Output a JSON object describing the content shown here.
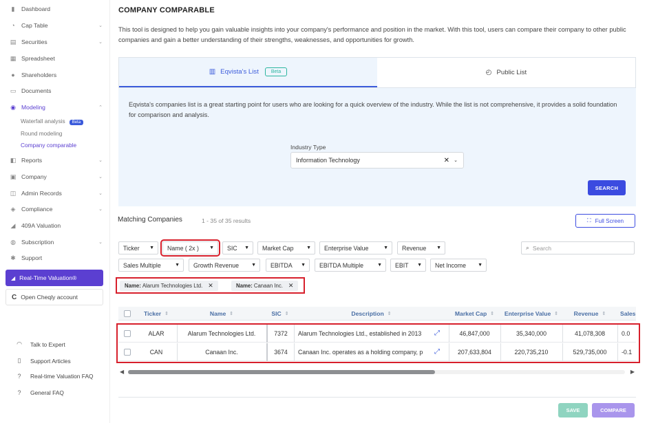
{
  "sidebar": {
    "items": [
      {
        "label": "Dashboard",
        "icon": "dashboard-icon",
        "chevron": false
      },
      {
        "label": "Cap Table",
        "icon": "pie-chart-icon",
        "chevron": true
      },
      {
        "label": "Securities",
        "icon": "document-stack-icon",
        "chevron": true
      },
      {
        "label": "Spreadsheet",
        "icon": "spreadsheet-icon",
        "chevron": false
      },
      {
        "label": "Shareholders",
        "icon": "person-icon",
        "chevron": false
      },
      {
        "label": "Documents",
        "icon": "folder-icon",
        "chevron": false
      },
      {
        "label": "Modeling",
        "icon": "lightbulb-icon",
        "chevron": true
      },
      {
        "label": "Reports",
        "icon": "chart-icon",
        "chevron": true
      },
      {
        "label": "Company",
        "icon": "building-icon",
        "chevron": true
      },
      {
        "label": "Admin Records",
        "icon": "records-icon",
        "chevron": true
      },
      {
        "label": "Compliance",
        "icon": "shield-icon",
        "chevron": true
      },
      {
        "label": "409A Valuation",
        "icon": "valuation-icon",
        "chevron": false
      },
      {
        "label": "Subscription",
        "icon": "subscription-icon",
        "chevron": true
      },
      {
        "label": "Support",
        "icon": "support-icon",
        "chevron": false
      }
    ],
    "modeling_sub": [
      {
        "label": "Waterfall analysis",
        "badge": "Beta"
      },
      {
        "label": "Round modeling",
        "badge": ""
      },
      {
        "label": "Company comparable",
        "badge": ""
      }
    ],
    "rtv_button": "Real-Time Valuation®",
    "cheqly_button": "Open Cheqly account",
    "footer": [
      {
        "label": "Talk to Expert",
        "icon": "headset-icon"
      },
      {
        "label": "Support Articles",
        "icon": "book-icon"
      },
      {
        "label": "Real-time Valuation FAQ",
        "icon": "question-icon"
      },
      {
        "label": "General FAQ",
        "icon": "question-icon"
      }
    ]
  },
  "main": {
    "title": "COMPANY COMPARABLE",
    "intro": "This tool is designed to help you gain valuable insights into your company's performance and position in the market. With this tool, users can compare their company to other public companies and gain a better understanding of their strengths, weaknesses, and opportunities for growth.",
    "tabs": [
      {
        "label": "Eqvista's List",
        "badge": "Beta",
        "active": true
      },
      {
        "label": "Public List",
        "badge": "",
        "active": false
      }
    ],
    "panel_text": "Eqvista's companies list is a great starting point for users who are looking for a quick overview of the industry. While the list is not comprehensive, it provides a solid foundation for comparison and analysis.",
    "industry_label": "Industry Type",
    "industry_value": "Information Technology",
    "search_button": "SEARCH",
    "matching_title": "Matching Companies",
    "results_text": "1 - 35 of 35 results",
    "fullscreen_button": "Full Screen",
    "filters_row1": [
      "Ticker",
      "Name ( 2x )",
      "SIC",
      "Market Cap",
      "Enterprise Value",
      "Revenue"
    ],
    "filters_row2": [
      "Sales Multiple",
      "Growth Revenue",
      "EBITDA",
      "EBITDA Multiple",
      "EBIT",
      "Net Income"
    ],
    "table_search_placeholder": "Search",
    "chips": [
      {
        "key": "Name:",
        "value": "Alarum Technologies Ltd."
      },
      {
        "key": "Name:",
        "value": "Canaan Inc."
      }
    ],
    "columns": [
      "Ticker",
      "Name",
      "SIC",
      "Description",
      "Market Cap",
      "Enterprise Value",
      "Revenue",
      "Sales"
    ],
    "rows": [
      {
        "ticker": "ALAR",
        "name": "Alarum Technologies Ltd.",
        "sic": "7372",
        "description": "Alarum Technologies Ltd., established in 2013",
        "market_cap": "46,847,000",
        "ev": "35,340,000",
        "revenue": "41,078,308",
        "sales": "0.0"
      },
      {
        "ticker": "CAN",
        "name": "Canaan Inc.",
        "sic": "3674",
        "description": "Canaan Inc. operates as a holding company, p",
        "market_cap": "207,633,804",
        "ev": "220,735,210",
        "revenue": "529,735,000",
        "sales": "-0.1"
      }
    ],
    "save_button": "SAVE",
    "compare_button": "COMPARE"
  }
}
